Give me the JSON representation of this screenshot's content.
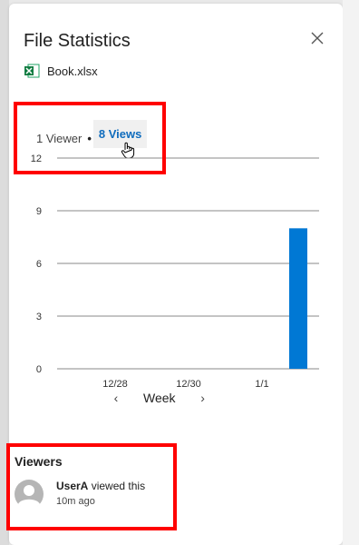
{
  "panel": {
    "title": "File Statistics",
    "file_name": "Book.xlsx"
  },
  "summary": {
    "viewers_text": "1 Viewer",
    "separator": "•",
    "views_link": "8 Views"
  },
  "chart_data": {
    "type": "bar",
    "categories": [
      "12/28",
      "12/30",
      "1/1"
    ],
    "bar_x_positions": [
      "after 1/1"
    ],
    "values": [
      0,
      0,
      0,
      8
    ],
    "ylim": [
      0,
      12
    ],
    "yticks": [
      0,
      3,
      6,
      9,
      12
    ],
    "grid": true,
    "bar_color": "#0078d4"
  },
  "week_nav": {
    "label": "Week",
    "prev": "‹",
    "next": "›"
  },
  "viewers": {
    "heading": "Viewers",
    "items": [
      {
        "user": "UserA",
        "action": "viewed this",
        "time": "10m ago"
      }
    ]
  },
  "colors": {
    "accent": "#0f6cbd",
    "highlight": "#ff0000"
  }
}
